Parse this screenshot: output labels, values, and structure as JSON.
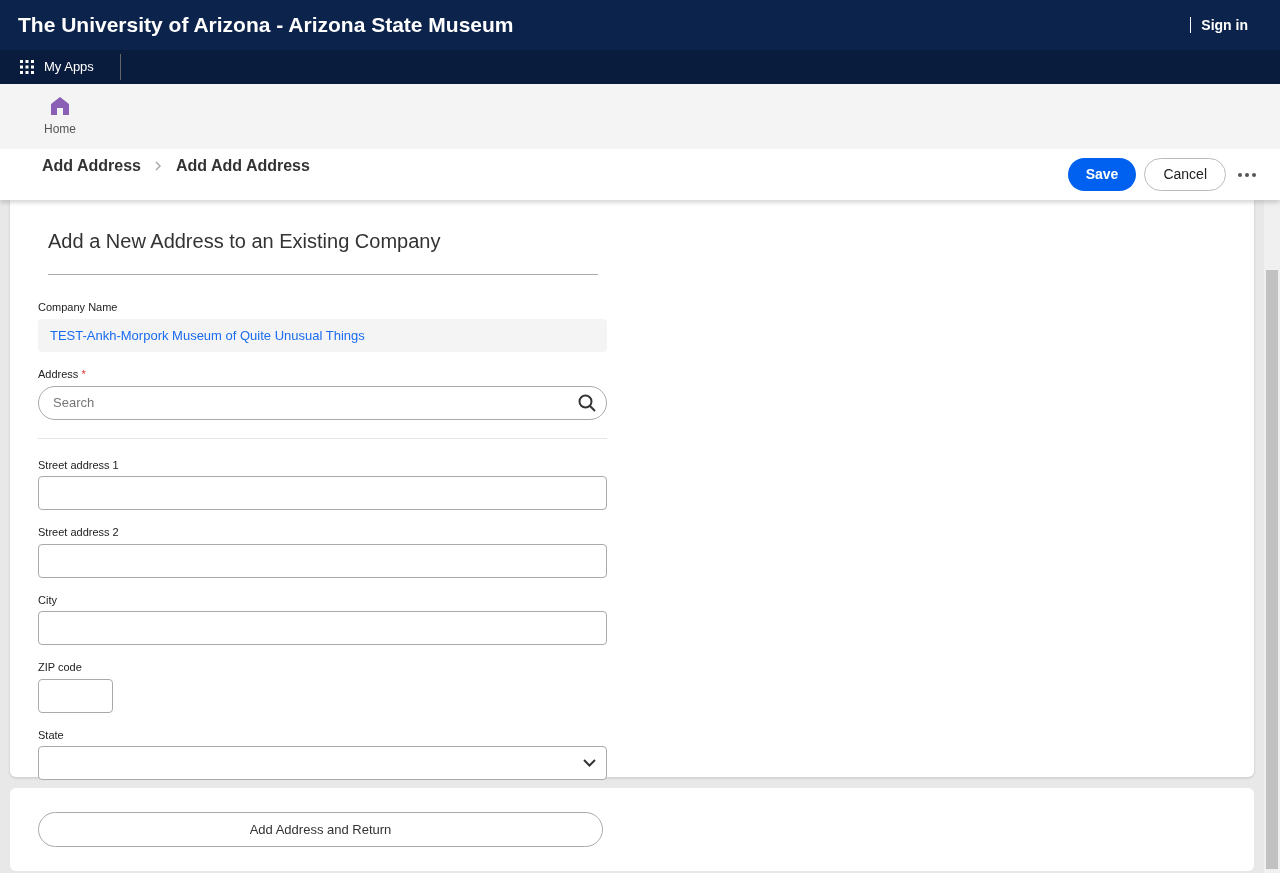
{
  "header": {
    "title": "The University of Arizona - Arizona State Museum",
    "sign_in": "Sign in"
  },
  "apps_bar": {
    "label": "My Apps"
  },
  "home": {
    "label": "Home"
  },
  "breadcrumb": [
    "Add Address",
    "Add Add Address"
  ],
  "actions": {
    "save": "Save",
    "cancel": "Cancel"
  },
  "form": {
    "title": "Add a New Address to an Existing Company",
    "required_mark": "*",
    "fields": [
      {
        "kind": "readonly",
        "label": "Company Name",
        "required": false,
        "value": "TEST-Ankh-Morpork Museum of Quite Unusual Things"
      },
      {
        "kind": "search",
        "label": "Address",
        "required": true,
        "placeholder": "Search"
      },
      {
        "kind": "divider"
      },
      {
        "kind": "text",
        "label": "Street address 1",
        "required": false
      },
      {
        "kind": "text",
        "label": "Street address 2",
        "required": false
      },
      {
        "kind": "text",
        "label": "City",
        "required": false
      },
      {
        "kind": "short",
        "label": "ZIP code",
        "required": false
      },
      {
        "kind": "select",
        "label": "State",
        "required": false
      }
    ]
  },
  "footer_button": "Add Address and Return"
}
